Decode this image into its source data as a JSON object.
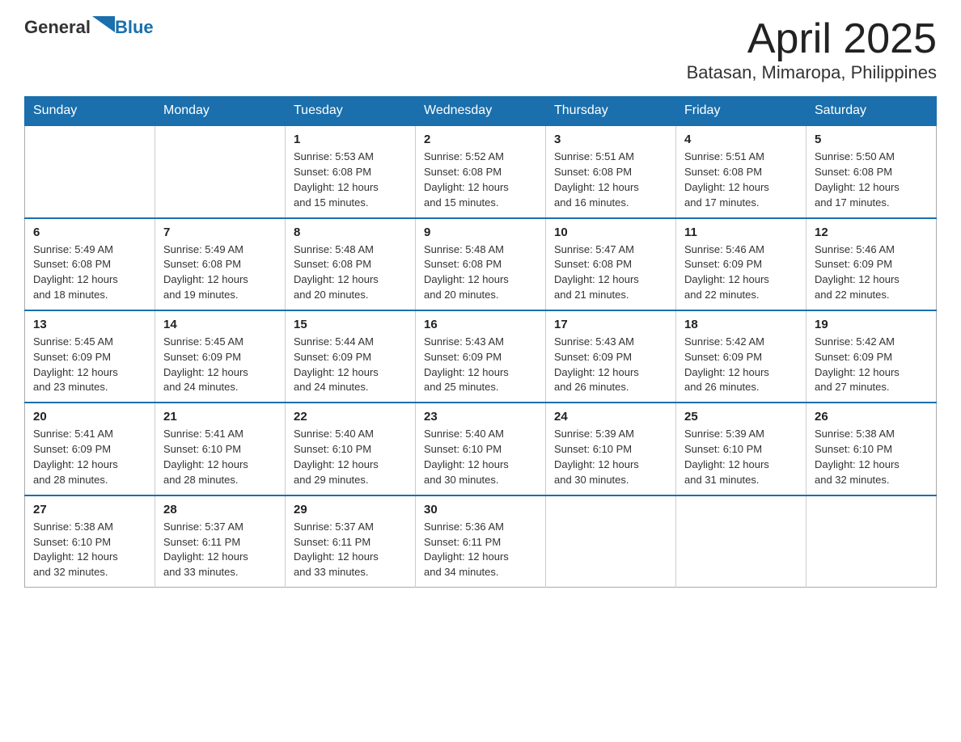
{
  "logo": {
    "general": "General",
    "blue": "Blue"
  },
  "title": "April 2025",
  "subtitle": "Batasan, Mimaropa, Philippines",
  "header_days": [
    "Sunday",
    "Monday",
    "Tuesday",
    "Wednesday",
    "Thursday",
    "Friday",
    "Saturday"
  ],
  "weeks": [
    [
      {
        "day": "",
        "info": ""
      },
      {
        "day": "",
        "info": ""
      },
      {
        "day": "1",
        "info": "Sunrise: 5:53 AM\nSunset: 6:08 PM\nDaylight: 12 hours\nand 15 minutes."
      },
      {
        "day": "2",
        "info": "Sunrise: 5:52 AM\nSunset: 6:08 PM\nDaylight: 12 hours\nand 15 minutes."
      },
      {
        "day": "3",
        "info": "Sunrise: 5:51 AM\nSunset: 6:08 PM\nDaylight: 12 hours\nand 16 minutes."
      },
      {
        "day": "4",
        "info": "Sunrise: 5:51 AM\nSunset: 6:08 PM\nDaylight: 12 hours\nand 17 minutes."
      },
      {
        "day": "5",
        "info": "Sunrise: 5:50 AM\nSunset: 6:08 PM\nDaylight: 12 hours\nand 17 minutes."
      }
    ],
    [
      {
        "day": "6",
        "info": "Sunrise: 5:49 AM\nSunset: 6:08 PM\nDaylight: 12 hours\nand 18 minutes."
      },
      {
        "day": "7",
        "info": "Sunrise: 5:49 AM\nSunset: 6:08 PM\nDaylight: 12 hours\nand 19 minutes."
      },
      {
        "day": "8",
        "info": "Sunrise: 5:48 AM\nSunset: 6:08 PM\nDaylight: 12 hours\nand 20 minutes."
      },
      {
        "day": "9",
        "info": "Sunrise: 5:48 AM\nSunset: 6:08 PM\nDaylight: 12 hours\nand 20 minutes."
      },
      {
        "day": "10",
        "info": "Sunrise: 5:47 AM\nSunset: 6:08 PM\nDaylight: 12 hours\nand 21 minutes."
      },
      {
        "day": "11",
        "info": "Sunrise: 5:46 AM\nSunset: 6:09 PM\nDaylight: 12 hours\nand 22 minutes."
      },
      {
        "day": "12",
        "info": "Sunrise: 5:46 AM\nSunset: 6:09 PM\nDaylight: 12 hours\nand 22 minutes."
      }
    ],
    [
      {
        "day": "13",
        "info": "Sunrise: 5:45 AM\nSunset: 6:09 PM\nDaylight: 12 hours\nand 23 minutes."
      },
      {
        "day": "14",
        "info": "Sunrise: 5:45 AM\nSunset: 6:09 PM\nDaylight: 12 hours\nand 24 minutes."
      },
      {
        "day": "15",
        "info": "Sunrise: 5:44 AM\nSunset: 6:09 PM\nDaylight: 12 hours\nand 24 minutes."
      },
      {
        "day": "16",
        "info": "Sunrise: 5:43 AM\nSunset: 6:09 PM\nDaylight: 12 hours\nand 25 minutes."
      },
      {
        "day": "17",
        "info": "Sunrise: 5:43 AM\nSunset: 6:09 PM\nDaylight: 12 hours\nand 26 minutes."
      },
      {
        "day": "18",
        "info": "Sunrise: 5:42 AM\nSunset: 6:09 PM\nDaylight: 12 hours\nand 26 minutes."
      },
      {
        "day": "19",
        "info": "Sunrise: 5:42 AM\nSunset: 6:09 PM\nDaylight: 12 hours\nand 27 minutes."
      }
    ],
    [
      {
        "day": "20",
        "info": "Sunrise: 5:41 AM\nSunset: 6:09 PM\nDaylight: 12 hours\nand 28 minutes."
      },
      {
        "day": "21",
        "info": "Sunrise: 5:41 AM\nSunset: 6:10 PM\nDaylight: 12 hours\nand 28 minutes."
      },
      {
        "day": "22",
        "info": "Sunrise: 5:40 AM\nSunset: 6:10 PM\nDaylight: 12 hours\nand 29 minutes."
      },
      {
        "day": "23",
        "info": "Sunrise: 5:40 AM\nSunset: 6:10 PM\nDaylight: 12 hours\nand 30 minutes."
      },
      {
        "day": "24",
        "info": "Sunrise: 5:39 AM\nSunset: 6:10 PM\nDaylight: 12 hours\nand 30 minutes."
      },
      {
        "day": "25",
        "info": "Sunrise: 5:39 AM\nSunset: 6:10 PM\nDaylight: 12 hours\nand 31 minutes."
      },
      {
        "day": "26",
        "info": "Sunrise: 5:38 AM\nSunset: 6:10 PM\nDaylight: 12 hours\nand 32 minutes."
      }
    ],
    [
      {
        "day": "27",
        "info": "Sunrise: 5:38 AM\nSunset: 6:10 PM\nDaylight: 12 hours\nand 32 minutes."
      },
      {
        "day": "28",
        "info": "Sunrise: 5:37 AM\nSunset: 6:11 PM\nDaylight: 12 hours\nand 33 minutes."
      },
      {
        "day": "29",
        "info": "Sunrise: 5:37 AM\nSunset: 6:11 PM\nDaylight: 12 hours\nand 33 minutes."
      },
      {
        "day": "30",
        "info": "Sunrise: 5:36 AM\nSunset: 6:11 PM\nDaylight: 12 hours\nand 34 minutes."
      },
      {
        "day": "",
        "info": ""
      },
      {
        "day": "",
        "info": ""
      },
      {
        "day": "",
        "info": ""
      }
    ]
  ]
}
